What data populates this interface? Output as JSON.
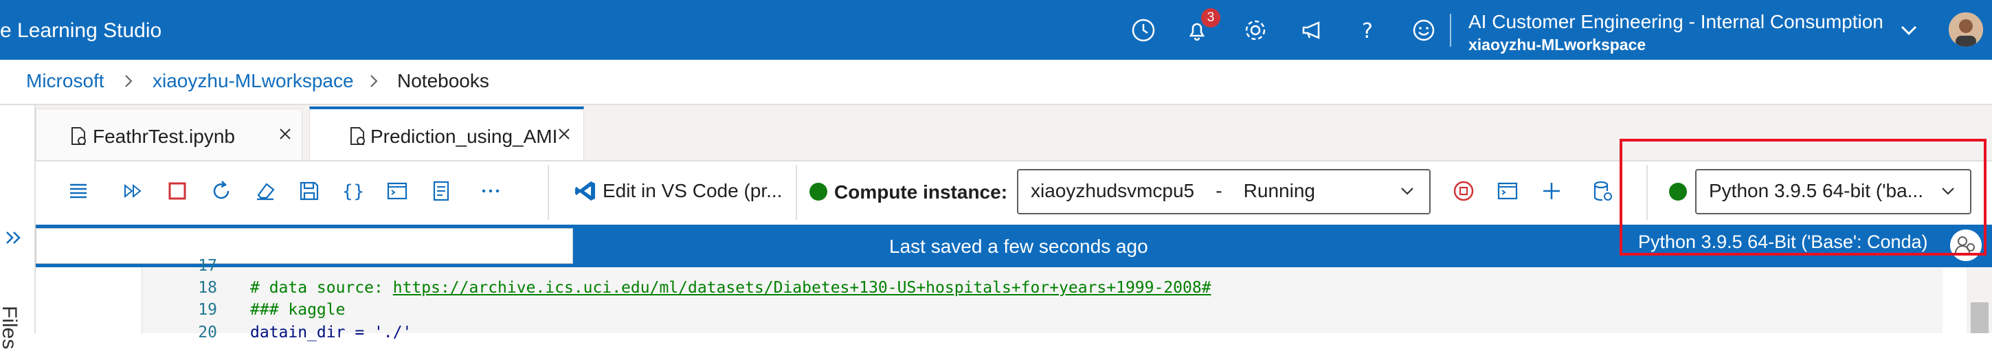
{
  "header": {
    "app_title": "e Learning Studio",
    "notification_count": "3",
    "subscription": "AI Customer Engineering - Internal Consumption",
    "workspace": "xiaoyzhu-MLworkspace",
    "icons": [
      "history-icon",
      "bell-icon",
      "gear-icon",
      "megaphone-icon",
      "help-icon",
      "smiley-icon",
      "chevron-down-icon",
      "avatar"
    ]
  },
  "breadcrumb": {
    "items": [
      "Microsoft",
      "xiaoyzhu-MLworkspace",
      "Notebooks"
    ]
  },
  "left_rail": {
    "files_label": "Files"
  },
  "tabs": [
    {
      "label": "FeathrTest.ipynb"
    },
    {
      "label": "Prediction_using_AMI"
    }
  ],
  "toolbar": {
    "edit_in_vscode": "Edit in VS Code (pr...",
    "compute_label": "Compute instance:",
    "compute_value": "xiaoyzhudsvmcpu5    -    Running",
    "kernel_value": "Python 3.9.5 64-bit ('ba..."
  },
  "status_bar": {
    "save_status": "Last saved a few seconds ago",
    "kernel_status": "Python 3.9.5 64-Bit ('Base': Conda)"
  },
  "code": {
    "lines": [
      {
        "no": "17",
        "prefix": "",
        "link": "",
        "suffix": ""
      },
      {
        "no": "18",
        "prefix": "# data source: ",
        "link": "https://archive.ics.uci.edu/ml/datasets/Diabetes+130-US+hospitals+for+years+1999-2008#",
        "suffix": ""
      },
      {
        "no": "19",
        "prefix": "### kaggle",
        "link": "",
        "suffix": ""
      },
      {
        "no": "20",
        "prefix": "datain_dir = './'",
        "link": "",
        "suffix": ""
      }
    ]
  },
  "colors": {
    "brand_blue": "#0f6cbd",
    "running_green": "#107c10",
    "highlight_red": "#e81123",
    "badge_red": "#d13438"
  }
}
